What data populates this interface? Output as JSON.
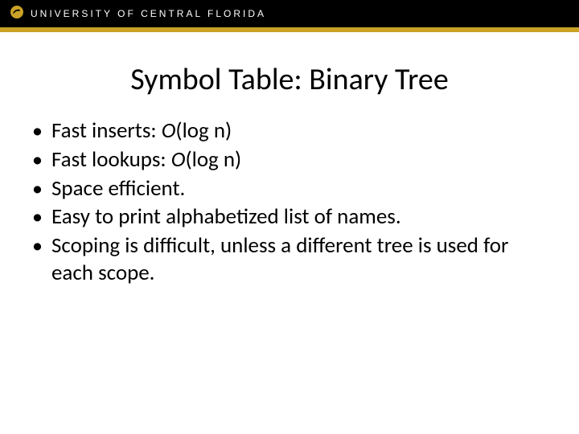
{
  "header": {
    "institution": "UNIVERSITY OF CENTRAL FLORIDA",
    "logo_color": "#c9a227"
  },
  "slide": {
    "title": "Symbol Table: Binary Tree",
    "bullets": [
      {
        "prefix": "Fast inserts: ",
        "bigO_var": "O",
        "complexity": "(log n)",
        "suffix": ""
      },
      {
        "prefix": "Fast lookups: ",
        "bigO_var": "O",
        "complexity": "(log n)",
        "suffix": ""
      },
      {
        "prefix": "Space efficient.",
        "bigO_var": "",
        "complexity": "",
        "suffix": ""
      },
      {
        "prefix": "Easy to print alphabetized list of names.",
        "bigO_var": "",
        "complexity": "",
        "suffix": ""
      },
      {
        "prefix": "Scoping is difficult, unless a different tree is used for each scope.",
        "bigO_var": "",
        "complexity": "",
        "suffix": ""
      }
    ]
  }
}
